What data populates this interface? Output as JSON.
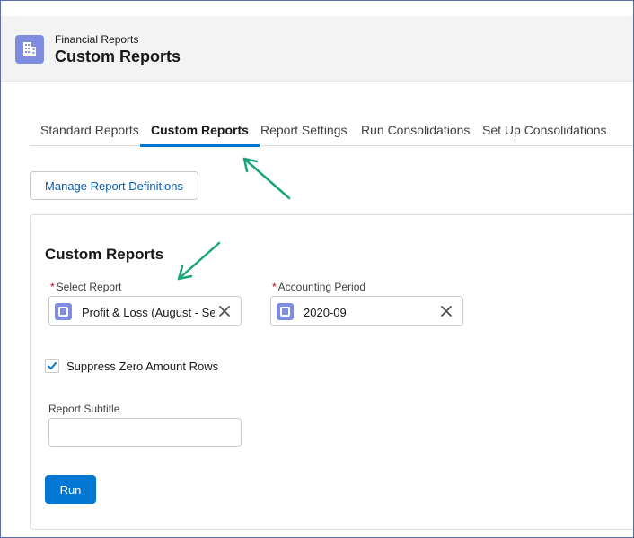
{
  "header": {
    "eyebrow": "Financial Reports",
    "title": "Custom Reports",
    "icon": "building-icon",
    "icon_color": "#7f8de1"
  },
  "tabs": [
    {
      "label": "Standard Reports",
      "active": false
    },
    {
      "label": "Custom Reports",
      "active": true
    },
    {
      "label": "Report Settings",
      "active": false
    },
    {
      "label": "Run Consolidations",
      "active": false
    },
    {
      "label": "Set Up Consolidations",
      "active": false
    }
  ],
  "manage_button": "Manage Report Definitions",
  "card": {
    "title": "Custom Reports",
    "select_report": {
      "label": "Select Report",
      "required": "*",
      "value": "Profit & Loss (August - Se"
    },
    "accounting_period": {
      "label": "Accounting Period",
      "required": "*",
      "value": "2020-09"
    },
    "suppress": {
      "label": "Suppress Zero Amount Rows",
      "checked": true
    },
    "subtitle": {
      "label": "Report Subtitle",
      "value": ""
    },
    "run_button": "Run"
  },
  "colors": {
    "brand": "#0176d3",
    "annotation_arrow": "#1aa57a"
  }
}
